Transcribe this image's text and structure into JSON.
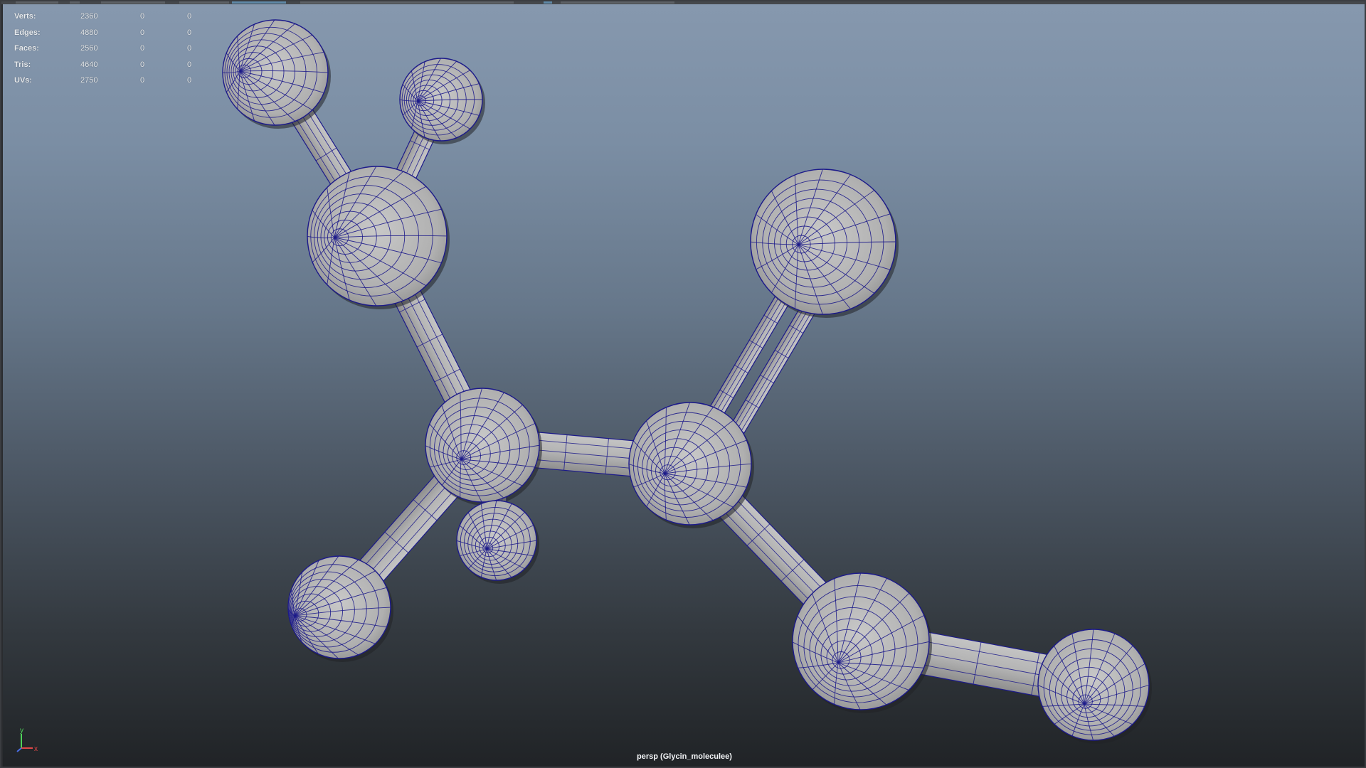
{
  "hud": {
    "rows": [
      {
        "label": "Verts:",
        "value": "2360",
        "selected": "0",
        "uv": "0"
      },
      {
        "label": "Edges:",
        "value": "4880",
        "selected": "0",
        "uv": "0"
      },
      {
        "label": "Faces:",
        "value": "2560",
        "selected": "0",
        "uv": "0"
      },
      {
        "label": "Tris:",
        "value": "4640",
        "selected": "0",
        "uv": "0"
      },
      {
        "label": "UVs:",
        "value": "2750",
        "selected": "0",
        "uv": "0"
      }
    ]
  },
  "viewport": {
    "camera_label": "persp (Glycin_moleculee)",
    "background_top": "#8698ae",
    "background_bottom": "#202326",
    "wire_color": "#1c1a8a",
    "shade_color": "#b3b3b3"
  },
  "axis_gizmo": {
    "y_label": "y",
    "x_label": "x",
    "y_color": "#4fd35a",
    "x_color": "#e04848",
    "z_color": "#4a6ee8"
  },
  "icons": [
    "axis-gizmo-icon"
  ]
}
